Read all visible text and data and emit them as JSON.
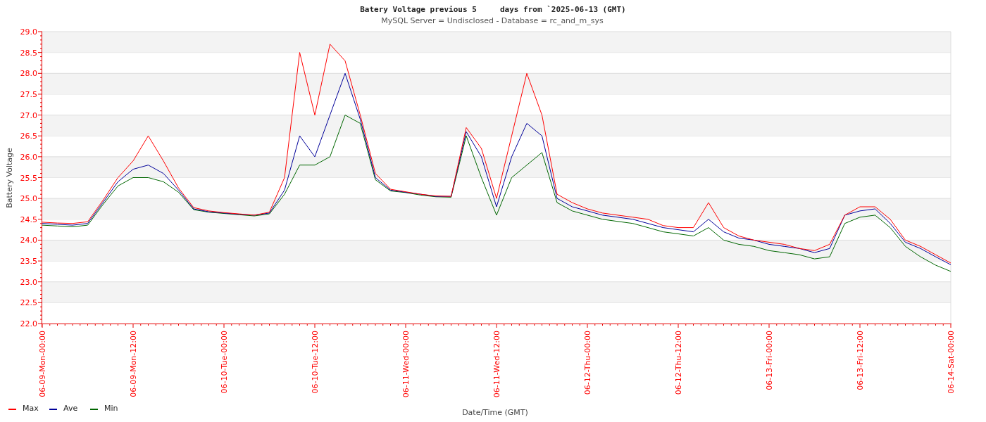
{
  "chart": {
    "subtitle": "MySQL Server = Undisclosed - Database = rc_and_m_sys",
    "chart_data": {
      "type": "line",
      "title": "Batery Voltage previous 5     days from `2025-06-13 (GMT)",
      "xlabel": "Date/Time (GMT)",
      "ylabel": "Battery Voltage",
      "categories": [
        "06-09-Mon-00:00",
        null,
        null,
        null,
        null,
        null,
        "06-09-Mon-12:00",
        null,
        null,
        null,
        null,
        null,
        "06-10-Tue-00:00",
        null,
        null,
        null,
        null,
        null,
        "06-10-Tue-12:00",
        null,
        null,
        null,
        null,
        null,
        "06-11-Wed-00:00",
        null,
        null,
        null,
        null,
        null,
        "06-11-Wed-12:00",
        null,
        null,
        null,
        null,
        null,
        "06-12-Thu-00:00",
        null,
        null,
        null,
        null,
        null,
        "06-12-Thu-12:00",
        null,
        null,
        null,
        null,
        null,
        "06-13-Fri-00:00",
        null,
        null,
        null,
        null,
        null,
        "06-13-Fri-12:00",
        null,
        null,
        null,
        null,
        null,
        "06-14-Sat-00:00"
      ],
      "series": [
        {
          "name": "Max",
          "color": "#ff0000",
          "values": [
            24.43,
            24.41,
            24.4,
            24.44,
            24.95,
            25.5,
            25.9,
            26.5,
            25.9,
            25.25,
            24.78,
            24.7,
            24.66,
            24.63,
            24.6,
            24.67,
            25.5,
            28.5,
            27.0,
            28.7,
            28.3,
            27.0,
            25.6,
            25.22,
            25.16,
            25.1,
            25.06,
            25.05,
            26.7,
            26.2,
            25.0,
            26.5,
            28.0,
            27.0,
            25.1,
            24.9,
            24.75,
            24.65,
            24.6,
            24.55,
            24.5,
            24.35,
            24.3,
            24.3,
            24.9,
            24.3,
            24.1,
            24.0,
            23.95,
            23.9,
            23.8,
            23.75,
            23.9,
            24.6,
            24.8,
            24.8,
            24.5,
            24.0,
            23.85,
            23.65,
            23.45
          ]
        },
        {
          "name": "Ave",
          "color": "#000099",
          "values": [
            24.4,
            24.38,
            24.36,
            24.4,
            24.9,
            25.4,
            25.7,
            25.8,
            25.6,
            25.2,
            24.75,
            24.68,
            24.65,
            24.62,
            24.6,
            24.65,
            25.2,
            26.5,
            26.0,
            27.0,
            28.0,
            26.9,
            25.5,
            25.2,
            25.15,
            25.1,
            25.05,
            25.05,
            26.6,
            26.0,
            24.8,
            26.0,
            26.8,
            26.5,
            25.0,
            24.8,
            24.7,
            24.6,
            24.55,
            24.5,
            24.4,
            24.3,
            24.25,
            24.2,
            24.5,
            24.2,
            24.05,
            24.0,
            23.9,
            23.85,
            23.8,
            23.7,
            23.8,
            24.6,
            24.7,
            24.75,
            24.4,
            23.95,
            23.8,
            23.6,
            23.41
          ]
        },
        {
          "name": "Min",
          "color": "#006600",
          "values": [
            24.36,
            24.34,
            24.32,
            24.36,
            24.85,
            25.3,
            25.5,
            25.5,
            25.4,
            25.15,
            24.73,
            24.67,
            24.64,
            24.61,
            24.58,
            24.63,
            25.1,
            25.8,
            25.8,
            26.0,
            27.0,
            26.8,
            25.45,
            25.18,
            25.14,
            25.08,
            25.04,
            25.03,
            26.5,
            25.5,
            24.6,
            25.5,
            25.8,
            26.1,
            24.9,
            24.7,
            24.6,
            24.5,
            24.45,
            24.4,
            24.3,
            24.2,
            24.15,
            24.1,
            24.3,
            24.0,
            23.9,
            23.85,
            23.75,
            23.7,
            23.65,
            23.55,
            23.6,
            24.4,
            24.55,
            24.6,
            24.3,
            23.85,
            23.6,
            23.4,
            23.25
          ]
        }
      ],
      "ylim": [
        22,
        29
      ],
      "grid": true,
      "legend": true,
      "yticks": [
        {
          "value": 22,
          "label": "22.0"
        },
        {
          "value": 22.5,
          "label": "22.5"
        },
        {
          "value": 23,
          "label": "23.0"
        },
        {
          "value": 23.5,
          "label": "23.5"
        },
        {
          "value": 24,
          "label": "24.0"
        },
        {
          "value": 24.5,
          "label": "24.5"
        },
        {
          "value": 25,
          "label": "25.0"
        },
        {
          "value": 25.5,
          "label": "25.5"
        },
        {
          "value": 26,
          "label": "26.0"
        },
        {
          "value": 26.5,
          "label": "26.5"
        },
        {
          "value": 27,
          "label": "27.0"
        },
        {
          "value": 27.5,
          "label": "27.5"
        },
        {
          "value": 28,
          "label": "28.0"
        },
        {
          "value": 28.5,
          "label": "28.5"
        },
        {
          "value": 29,
          "label": "29.0"
        }
      ]
    }
  }
}
